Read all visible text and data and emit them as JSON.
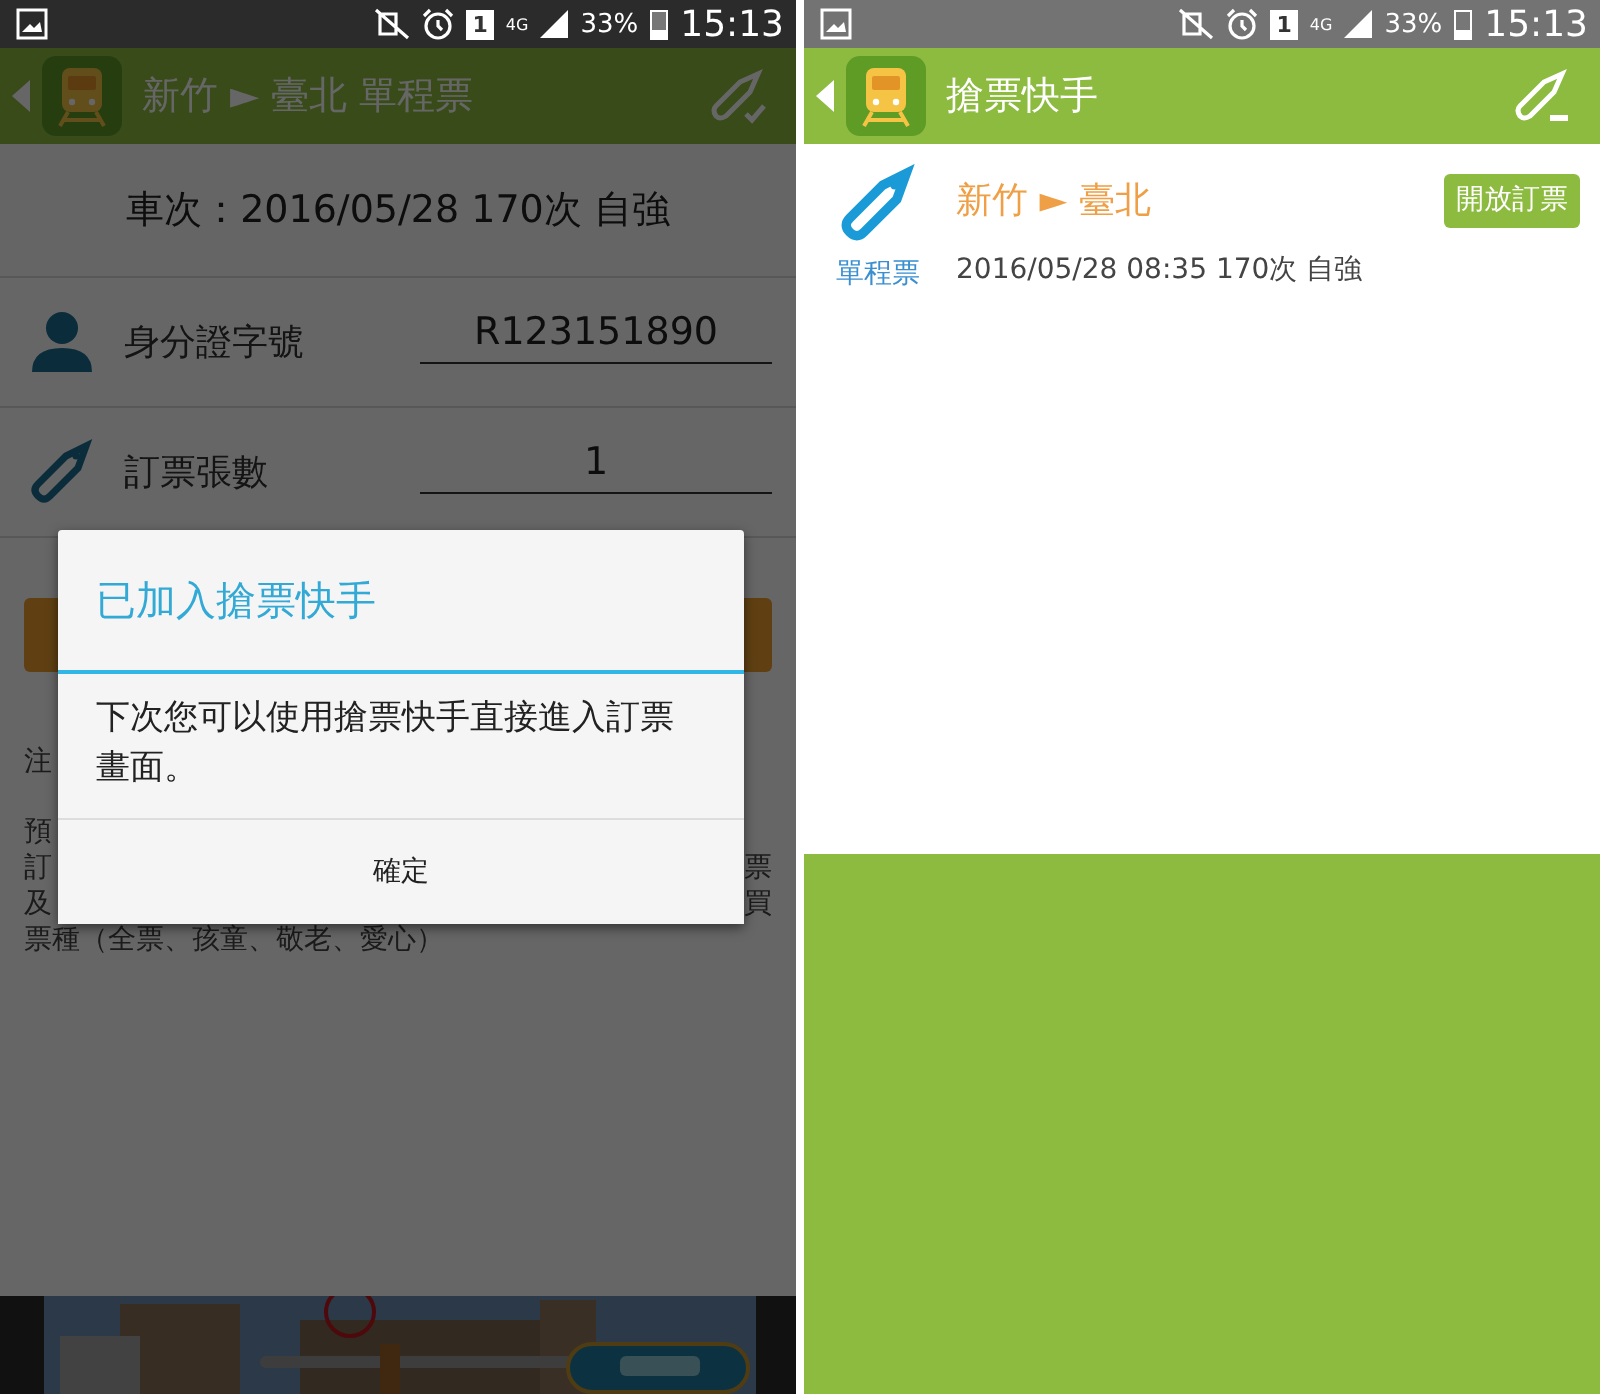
{
  "booking_screen": {
    "dimmed": true,
    "status_bar": {
      "sim": "1",
      "network": "4G",
      "battery": "33%",
      "time": "15:13"
    },
    "app_bar": {
      "title": "新竹 ► 臺北 單程票"
    },
    "train_info": "車次：2016/05/28 170次 自強",
    "form": [
      {
        "kind": "person",
        "label": "身分證字號",
        "value": "R123151890"
      },
      {
        "kind": "ticket",
        "label": "訂票張數",
        "value": "1"
      }
    ],
    "notes": [
      [
        {
          "left": "注"
        }
      ],
      [
        {
          "left": "預"
        },
        {
          "left": "訂",
          "right": "票"
        },
        {
          "left": "及",
          "right": "買"
        },
        {
          "left": "票種（全票、孩童、敬老、愛心）"
        }
      ]
    ],
    "dialog": {
      "title": "已加入搶票快手",
      "message": "下次您可以使用搶票快手直接進入訂票畫面。",
      "button": "確定"
    },
    "ad": {
      "kind": "picture"
    }
  },
  "quick_booking_screen": {
    "status_bar": {
      "sim": "1",
      "network": "4G",
      "battery": "33%",
      "time": "15:13"
    },
    "app_bar": {
      "title": "搶票快手"
    },
    "items": [
      {
        "type_label": "單程票",
        "route": "新竹 ► 臺北",
        "button": "開放訂票",
        "details": "2016/05/28 08:35 170次 自強"
      }
    ]
  }
}
